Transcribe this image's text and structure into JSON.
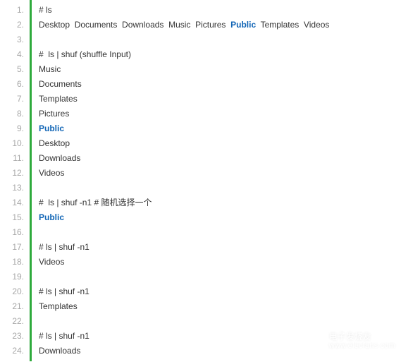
{
  "lines": [
    {
      "n": "1.",
      "tokens": [
        {
          "t": "# ls"
        }
      ]
    },
    {
      "n": "2.",
      "tokens": [
        {
          "t": "Desktop  Documents  Downloads  Music  Pictures  "
        },
        {
          "t": "Public",
          "hl": true
        },
        {
          "t": "  Templates  Videos"
        }
      ]
    },
    {
      "n": "3.",
      "tokens": []
    },
    {
      "n": "4.",
      "tokens": [
        {
          "t": "#  ls | shuf (shuffle Input)"
        }
      ]
    },
    {
      "n": "5.",
      "tokens": [
        {
          "t": "Music"
        }
      ]
    },
    {
      "n": "6.",
      "tokens": [
        {
          "t": "Documents"
        }
      ]
    },
    {
      "n": "7.",
      "tokens": [
        {
          "t": "Templates"
        }
      ]
    },
    {
      "n": "8.",
      "tokens": [
        {
          "t": "Pictures"
        }
      ]
    },
    {
      "n": "9.",
      "tokens": [
        {
          "t": "Public",
          "hl": true
        }
      ]
    },
    {
      "n": "10.",
      "tokens": [
        {
          "t": "Desktop"
        }
      ]
    },
    {
      "n": "11.",
      "tokens": [
        {
          "t": "Downloads"
        }
      ]
    },
    {
      "n": "12.",
      "tokens": [
        {
          "t": "Videos"
        }
      ]
    },
    {
      "n": "13.",
      "tokens": []
    },
    {
      "n": "14.",
      "tokens": [
        {
          "t": "#  ls | shuf -n1 # 随机选择一个"
        }
      ]
    },
    {
      "n": "15.",
      "tokens": [
        {
          "t": "Public",
          "hl": true
        }
      ]
    },
    {
      "n": "16.",
      "tokens": []
    },
    {
      "n": "17.",
      "tokens": [
        {
          "t": "# ls | shuf -n1"
        }
      ]
    },
    {
      "n": "18.",
      "tokens": [
        {
          "t": "Videos"
        }
      ]
    },
    {
      "n": "19.",
      "tokens": []
    },
    {
      "n": "20.",
      "tokens": [
        {
          "t": "# ls | shuf -n1"
        }
      ]
    },
    {
      "n": "21.",
      "tokens": [
        {
          "t": "Templates"
        }
      ]
    },
    {
      "n": "22.",
      "tokens": []
    },
    {
      "n": "23.",
      "tokens": [
        {
          "t": "# ls | shuf -n1"
        }
      ]
    },
    {
      "n": "24.",
      "tokens": [
        {
          "t": "Downloads"
        }
      ]
    }
  ],
  "watermark": {
    "cn": "电子发烧友",
    "url": "www.elecfans.com"
  }
}
